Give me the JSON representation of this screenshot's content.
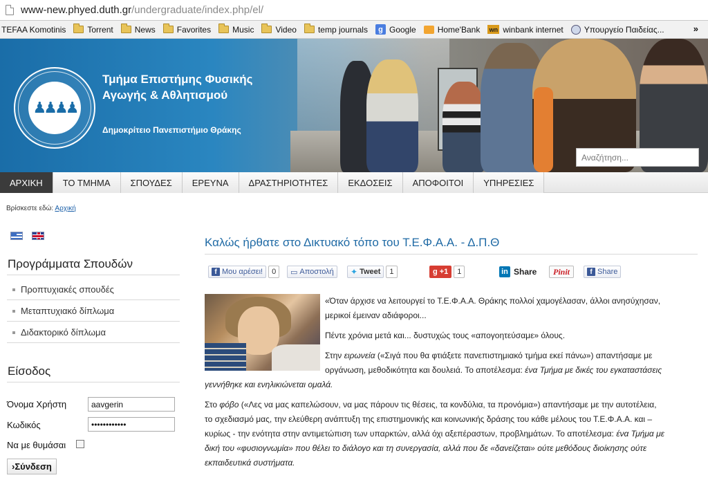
{
  "browser": {
    "url_host": "www-new.phyed.duth.gr",
    "url_path": "/undergraduate/index.php/el/"
  },
  "bookmarks": [
    {
      "label": "TEFAA Komotinis",
      "icon": "none"
    },
    {
      "label": "Torrent",
      "icon": "folder"
    },
    {
      "label": "News",
      "icon": "folder"
    },
    {
      "label": "Favorites",
      "icon": "folder"
    },
    {
      "label": "Music",
      "icon": "folder"
    },
    {
      "label": "Video",
      "icon": "folder"
    },
    {
      "label": "temp journals",
      "icon": "folder"
    },
    {
      "label": "Google",
      "icon": "google"
    },
    {
      "label": "Home'Bank",
      "icon": "homebank"
    },
    {
      "label": "winbank internet",
      "icon": "wn"
    },
    {
      "label": "Υπουργείο Παιδείας...",
      "icon": "globe"
    }
  ],
  "bookmarks_more": "»",
  "header": {
    "title_line1": "Τμήμα Επιστήμης Φυσικής",
    "title_line2": "Αγωγής & Αθλητισμού",
    "university": "Δημοκρίτειο Πανεπιστήμιο Θράκης",
    "search_placeholder": "Αναζήτηση..."
  },
  "nav": [
    {
      "label": "ΑΡΧΙΚΗ",
      "active": true
    },
    {
      "label": "ΤΟ ΤΜΗΜΑ",
      "active": false
    },
    {
      "label": "ΣΠΟΥΔΕΣ",
      "active": false
    },
    {
      "label": "ΕΡΕΥΝΑ",
      "active": false
    },
    {
      "label": "ΔΡΑΣΤΗΡΙΟΤΗΤΕΣ",
      "active": false
    },
    {
      "label": "ΕΚΔΟΣΕΙΣ",
      "active": false
    },
    {
      "label": "ΑΠΟΦΟΙΤΟΙ",
      "active": false
    },
    {
      "label": "ΥΠΗΡΕΣΙΕΣ",
      "active": false
    }
  ],
  "breadcrumb": {
    "prefix": "Βρίσκεστε εδώ:",
    "link": "Αρχική"
  },
  "sidebar": {
    "programs_heading": "Προγράμματα Σπουδών",
    "programs": [
      "Προπτυχιακές σπουδές",
      "Μεταπτυχιακό δίπλωμα",
      "Διδακτορικό δίπλωμα"
    ],
    "login_heading": "Είσοδος",
    "username_label": "Όνομα Χρήστη",
    "username_value": "aavgerin",
    "password_label": "Κωδικός",
    "password_value": "••••••••••••",
    "remember_label": "Να με θυμάσαι",
    "login_button": "›Σύνδεση"
  },
  "article": {
    "title": "Καλώς ήρθατε στο Δικτυακό τόπο του Τ.Ε.Φ.Α.Α. - Δ.Π.Θ",
    "share": {
      "like_label": "Μου αρέσει!",
      "like_count": "0",
      "send_label": "Αποστολή",
      "tweet_label": "Tweet",
      "tweet_count": "1",
      "gplus_label": "+1",
      "gplus_count": "1",
      "linkedin_label": "Share",
      "pinterest_label": "Pinit",
      "fb_share_label": "Share"
    },
    "p1": "«Όταν άρχισε να λειτουργεί το Τ.Ε.Φ.Α.Α. Θράκης πολλοί χαμογέλασαν, άλλοι ανησύχησαν,",
    "p1b": "μερικοί έμειναν αδιάφοροι...",
    "p2": "Πέντε χρόνια μετά και... δυστυχώς τους «απογοητεύσαμε» όλους.",
    "p3a": "Στην ",
    "p3_italic1": "ειρωνεία",
    "p3b": " («Σιγά που θα φτιάξετε πανεπιστημιακό τμήμα εκεί πάνω») απαντήσαμε με",
    "p3c": "οργάνωση, μεθοδικότητα και δουλειά. Το αποτέλεσμα: ",
    "p3_italic2": "ένα Τμήμα με δικές του εγκαταστάσεις",
    "p3_italic3": "γεννήθηκε και ενηλικιώνεται ομαλά.",
    "p4a": "Στο ",
    "p4_italic1": "φόβο",
    "p4b": " («Λες να μας καπελώσουν, να μας πάρουν τις θέσεις, τα κονδύλια, τα προνόμια») απαντήσαμε με την αυτοτέλεια,",
    "p4c": "το σχεδιασμό μας, την ελεύθερη ανάπτυξη της επιστημονικής και κοινωνικής δράσης του κάθε μέλους του Τ.Ε.Φ.Α.Α. και –",
    "p4d": "κυρίως - την ενότητα στην αντιμετώπιση των υπαρκτών, αλλά όχι αξεπέραστων, προβλημάτων. Το αποτέλεσμα: ",
    "p4_italic2": "ένα Τμήμα με",
    "p4_italic3": "δική του «φυσιογνωμία» που θέλει το διάλογο και τη συνεργασία, αλλά που δε «δανείζεται» ούτε μεθόδους διοίκησης ούτε",
    "p4_italic4": "εκπαιδευτικά συστήματα."
  },
  "colors": {
    "accent_title": "#1f6aa5",
    "banner_blue": "#1a6da8",
    "nav_active": "#3b3b3b"
  }
}
